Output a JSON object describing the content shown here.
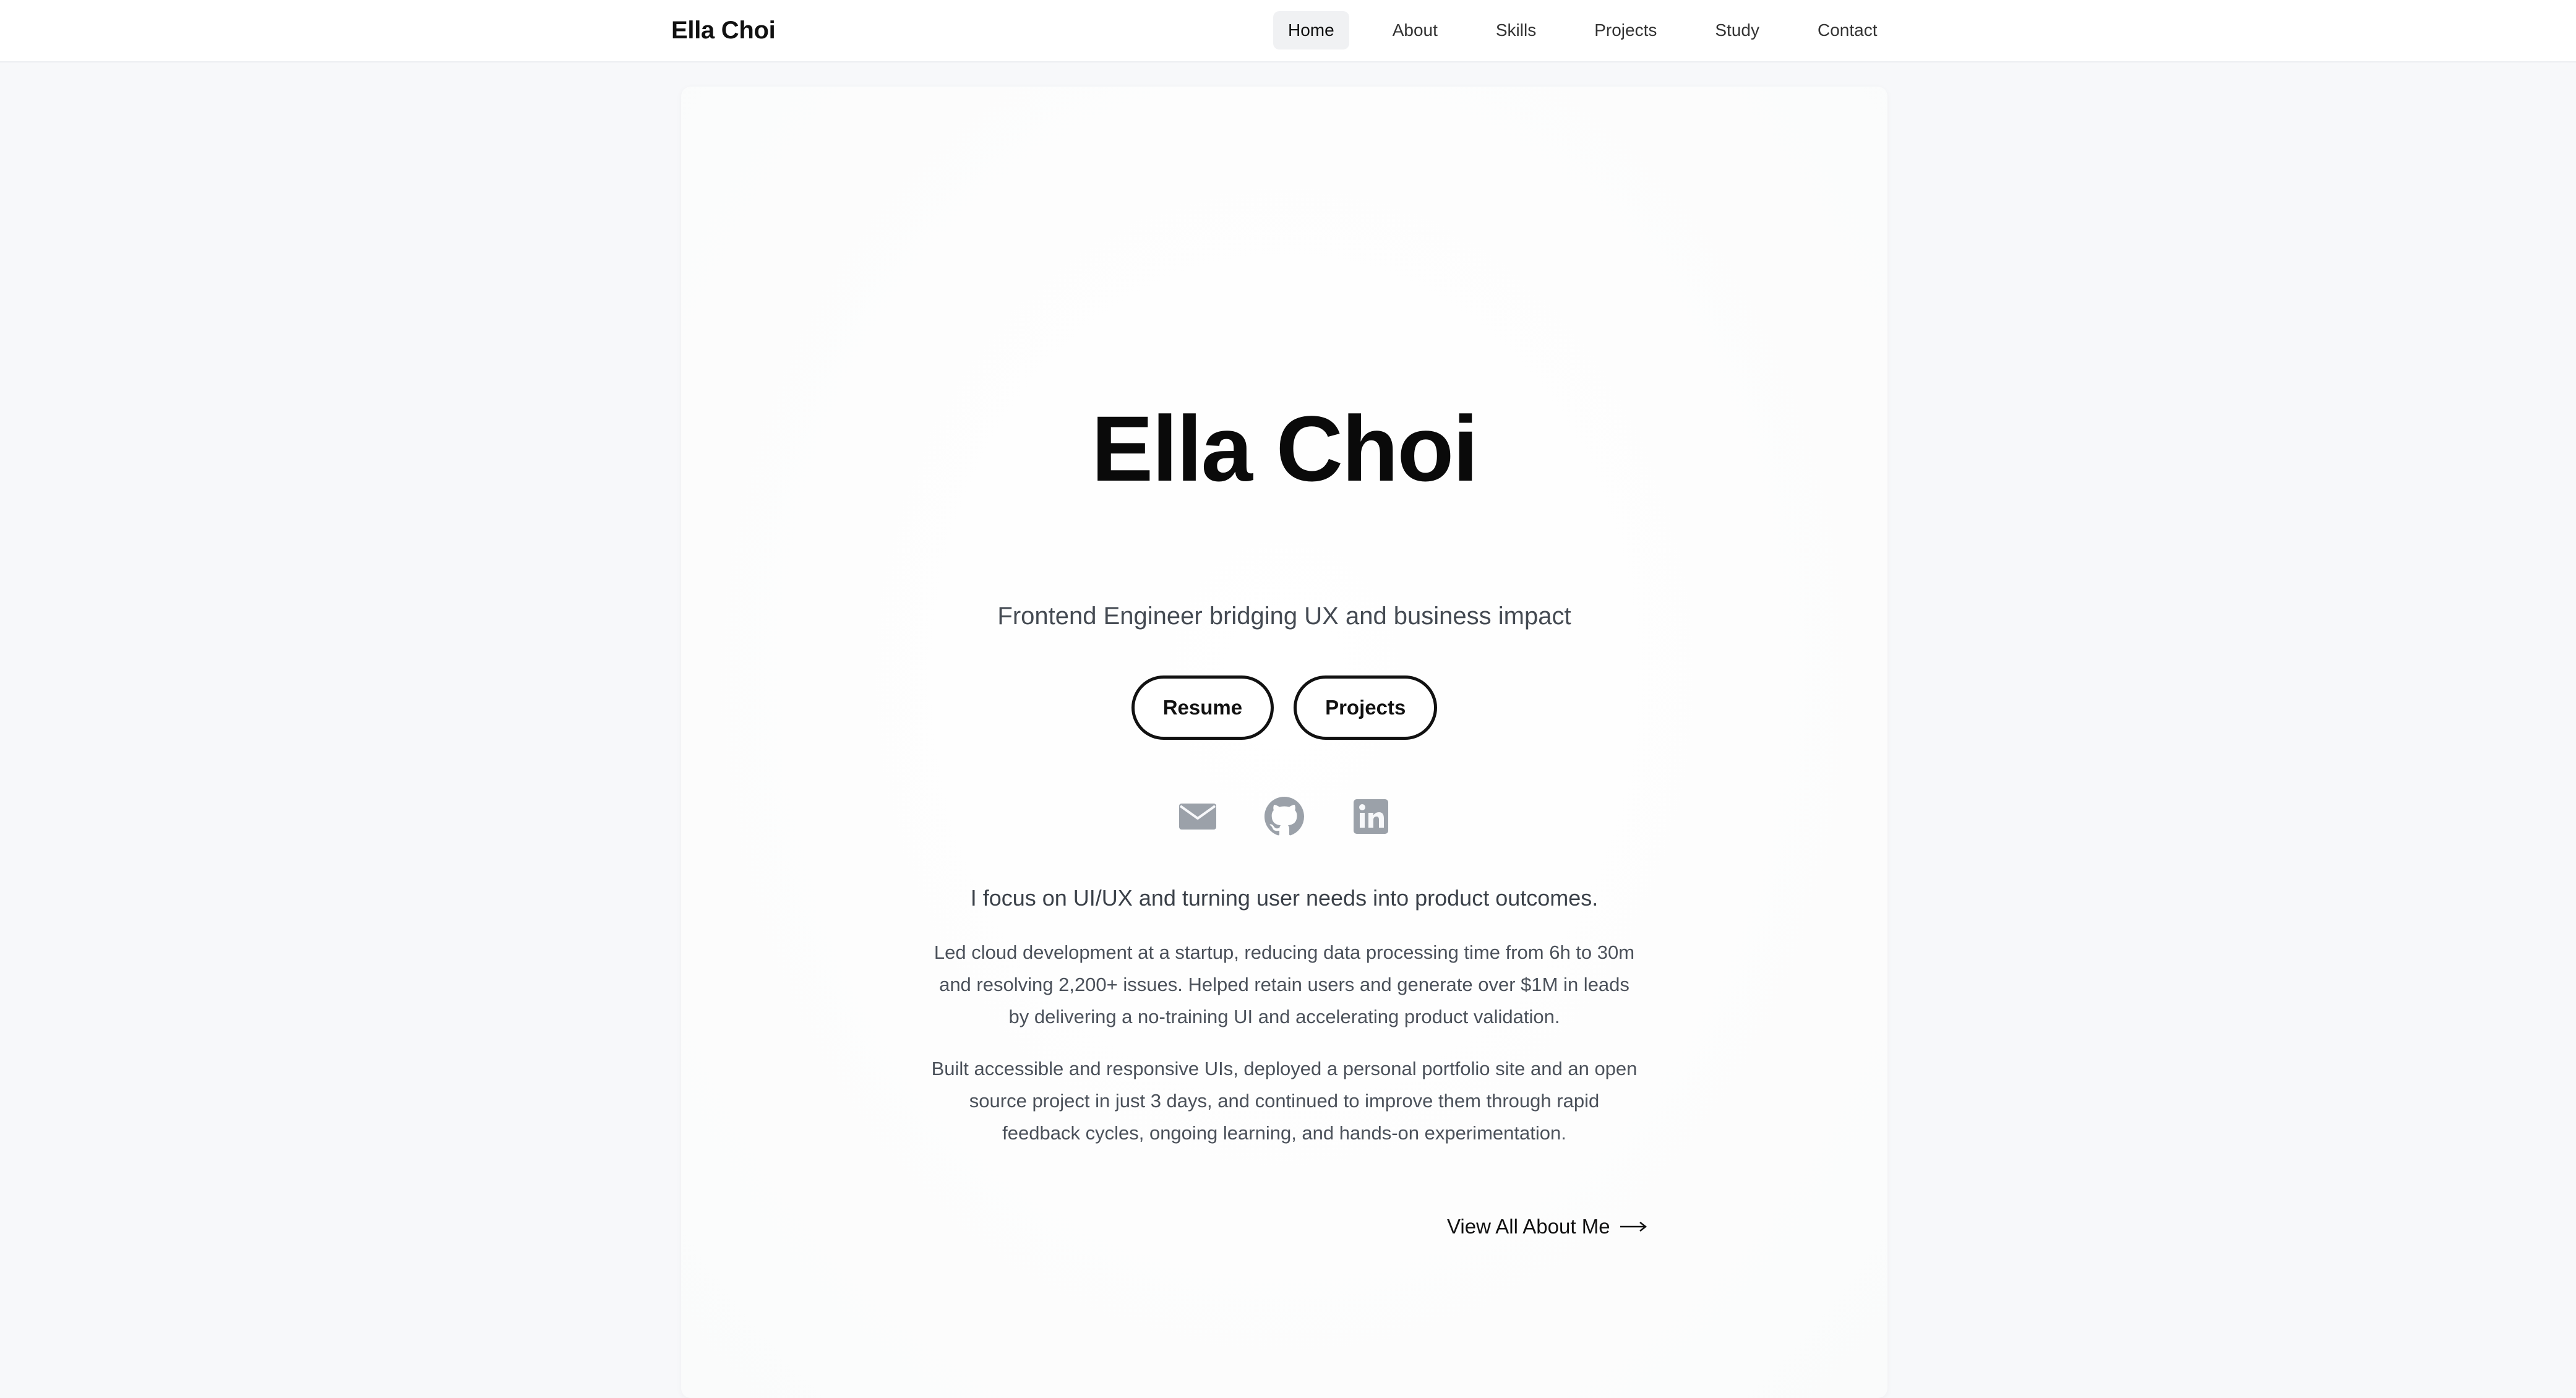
{
  "header": {
    "brand": "Ella Choi",
    "nav": [
      {
        "label": "Home",
        "active": true
      },
      {
        "label": "About",
        "active": false
      },
      {
        "label": "Skills",
        "active": false
      },
      {
        "label": "Projects",
        "active": false
      },
      {
        "label": "Study",
        "active": false
      },
      {
        "label": "Contact",
        "active": false
      }
    ]
  },
  "hero": {
    "name": "Ella Choi",
    "subtitle": "Frontend Engineer bridging UX and business impact",
    "buttons": {
      "resume": "Resume",
      "projects": "Projects"
    },
    "social_icons": [
      "envelope-icon",
      "github-icon",
      "linkedin-icon"
    ],
    "intro": "I focus on UI/UX and turning user needs into product outcomes.",
    "paragraph1": "Led cloud development at a startup, reducing data processing time from 6h to 30m and resolving 2,200+ issues. Helped retain users and generate over $1M in leads by delivering a no-training UI and accelerating product validation.",
    "paragraph2": "Built accessible and responsive UIs, deployed a personal portfolio site and an open source project in just 3 days, and continued to improve them through rapid feedback cycles, ongoing learning, and hands-on experimentation.",
    "more_link": "View All About Me"
  },
  "colors": {
    "page_bg": "#f7f8fa",
    "icon_gray": "#9ba1a9",
    "accent": "#111111"
  }
}
